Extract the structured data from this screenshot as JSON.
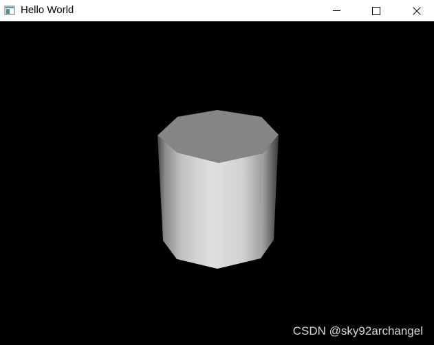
{
  "window": {
    "title": "Hello World",
    "icon": "window-app-icon",
    "controls": {
      "minimize_icon": "minimize-icon",
      "maximize_icon": "maximize-icon",
      "close_icon": "close-icon"
    }
  },
  "viewport": {
    "background": "#000000",
    "object": "octagonal-prism",
    "top_face_color": "#858585",
    "side_highlight_color": "#dedede",
    "side_shadow_color": "#4a4a4a",
    "watermark": "CSDN @sky92archangel"
  }
}
